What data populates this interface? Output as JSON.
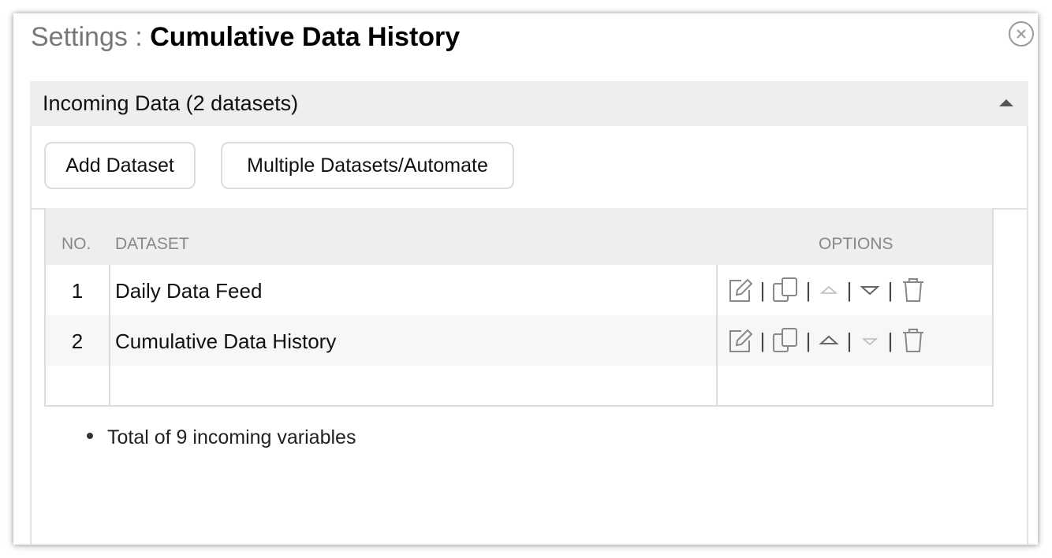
{
  "dialog": {
    "title_prefix": "Settings : ",
    "title_name": "Cumulative Data History",
    "close_icon": "close-circle-icon"
  },
  "section": {
    "header": "Incoming Data (2 datasets)",
    "collapse_icon": "caret-up-icon"
  },
  "buttons": {
    "add_dataset": "Add Dataset",
    "multiple": "Multiple Datasets/Automate"
  },
  "table": {
    "columns": [
      "NO.",
      "DATASET",
      "OPTIONS"
    ],
    "rows": [
      {
        "no": "1",
        "dataset": "Daily Data Feed"
      },
      {
        "no": "2",
        "dataset": "Cumulative Data History"
      }
    ],
    "option_icons": [
      "edit-icon",
      "copy-icon",
      "move-up-icon",
      "move-down-icon",
      "delete-icon"
    ],
    "separator": "|"
  },
  "summary": {
    "text": "Total of 9 incoming variables"
  }
}
